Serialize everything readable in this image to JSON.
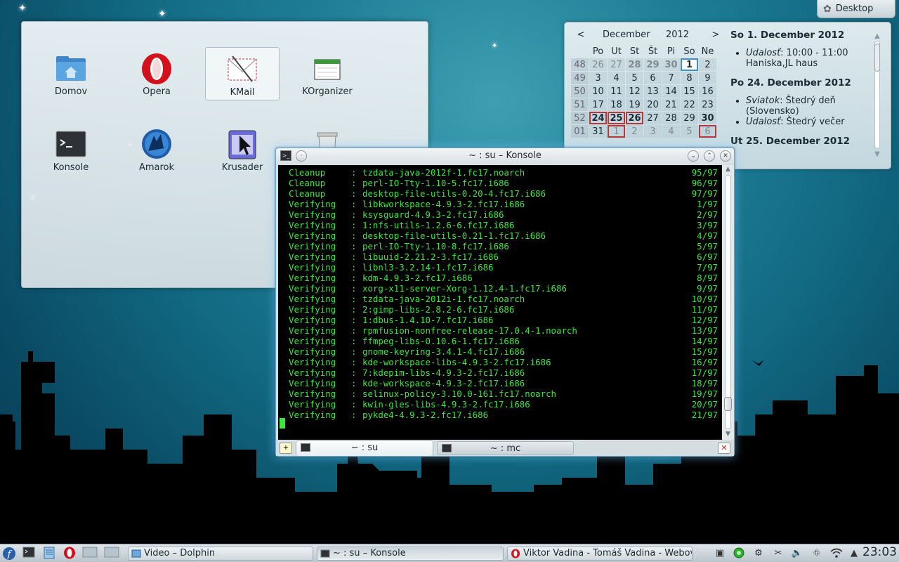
{
  "toolbox": {
    "label": "Desktop"
  },
  "folderview": {
    "items": [
      {
        "label": "Domov"
      },
      {
        "label": "Opera"
      },
      {
        "label": "KMail"
      },
      {
        "label": "KOrganizer"
      },
      {
        "label": "Konsole"
      },
      {
        "label": "Amarok"
      },
      {
        "label": "Krusader"
      }
    ]
  },
  "calendar": {
    "prev": "<",
    "next": ">",
    "month": "December",
    "year": "2012",
    "weekdays": [
      "Po",
      "Ut",
      "St",
      "Št",
      "Pi",
      "So",
      "Ne"
    ],
    "weeks": [
      {
        "num": "48",
        "days": [
          "26",
          "27",
          "28",
          "29",
          "30",
          "1",
          "2"
        ]
      },
      {
        "num": "49",
        "days": [
          "3",
          "4",
          "5",
          "6",
          "7",
          "8",
          "9"
        ]
      },
      {
        "num": "50",
        "days": [
          "10",
          "11",
          "12",
          "13",
          "14",
          "15",
          "16"
        ]
      },
      {
        "num": "51",
        "days": [
          "17",
          "18",
          "19",
          "20",
          "21",
          "22",
          "23"
        ]
      },
      {
        "num": "52",
        "days": [
          "24",
          "25",
          "26",
          "27",
          "28",
          "29",
          "30"
        ]
      },
      {
        "num": "01",
        "days": [
          "31",
          "1",
          "2",
          "3",
          "4",
          "5",
          "6"
        ]
      }
    ],
    "events": [
      {
        "date": "So 1. December 2012",
        "items": [
          {
            "kind": "Udalosť",
            "text": ": 10:00 - 11:00 Haniska,JL haus"
          }
        ]
      },
      {
        "date": "Po 24. December 2012",
        "items": [
          {
            "kind": "Sviatok",
            "text": ": Štedrý deň (Slovensko)"
          },
          {
            "kind": "Udalosť",
            "text": ": Štedrý večer"
          }
        ]
      },
      {
        "date": "Ut 25. December 2012",
        "items": []
      }
    ]
  },
  "konsole": {
    "title": "~ : su – Konsole",
    "lines": [
      {
        "action": "Cleanup",
        "package": "tzdata-java-2012f-1.fc17.noarch",
        "count": "95/97"
      },
      {
        "action": "Cleanup",
        "package": "perl-IO-Tty-1.10-5.fc17.i686",
        "count": "96/97"
      },
      {
        "action": "Cleanup",
        "package": "desktop-file-utils-0.20-4.fc17.i686",
        "count": "97/97"
      },
      {
        "action": "Verifying",
        "package": "libkworkspace-4.9.3-2.fc17.i686",
        "count": "1/97"
      },
      {
        "action": "Verifying",
        "package": "ksysguard-4.9.3-2.fc17.i686",
        "count": "2/97"
      },
      {
        "action": "Verifying",
        "package": "1:nfs-utils-1.2.6-6.fc17.i686",
        "count": "3/97"
      },
      {
        "action": "Verifying",
        "package": "desktop-file-utils-0.21-1.fc17.i686",
        "count": "4/97"
      },
      {
        "action": "Verifying",
        "package": "perl-IO-Tty-1.10-8.fc17.i686",
        "count": "5/97"
      },
      {
        "action": "Verifying",
        "package": "libuuid-2.21.2-3.fc17.i686",
        "count": "6/97"
      },
      {
        "action": "Verifying",
        "package": "libnl3-3.2.14-1.fc17.i686",
        "count": "7/97"
      },
      {
        "action": "Verifying",
        "package": "kdm-4.9.3-2.fc17.i686",
        "count": "8/97"
      },
      {
        "action": "Verifying",
        "package": "xorg-x11-server-Xorg-1.12.4-1.fc17.i686",
        "count": "9/97"
      },
      {
        "action": "Verifying",
        "package": "tzdata-java-2012i-1.fc17.noarch",
        "count": "10/97"
      },
      {
        "action": "Verifying",
        "package": "2:gimp-libs-2.8.2-6.fc17.i686",
        "count": "11/97"
      },
      {
        "action": "Verifying",
        "package": "1:dbus-1.4.10-7.fc17.i686",
        "count": "12/97"
      },
      {
        "action": "Verifying",
        "package": "rpmfusion-nonfree-release-17.0.4-1.noarch",
        "count": "13/97"
      },
      {
        "action": "Verifying",
        "package": "ffmpeg-libs-0.10.6-1.fc17.i686",
        "count": "14/97"
      },
      {
        "action": "Verifying",
        "package": "gnome-keyring-3.4.1-4.fc17.i686",
        "count": "15/97"
      },
      {
        "action": "Verifying",
        "package": "kde-workspace-libs-4.9.3-2.fc17.i686",
        "count": "16/97"
      },
      {
        "action": "Verifying",
        "package": "7:kdepim-libs-4.9.3-2.fc17.i686",
        "count": "17/97"
      },
      {
        "action": "Verifying",
        "package": "kde-workspace-4.9.3-2.fc17.i686",
        "count": "18/97"
      },
      {
        "action": "Verifying",
        "package": "selinux-policy-3.10.0-161.fc17.noarch",
        "count": "19/97"
      },
      {
        "action": "Verifying",
        "package": "kwin-gles-libs-4.9.3-2.fc17.i686",
        "count": "20/97"
      },
      {
        "action": "Verifying",
        "package": "pykde4-4.9.3-2.fc17.i686",
        "count": "21/97"
      }
    ],
    "tabs": [
      {
        "label": "~ : su"
      },
      {
        "label": "~ : mc"
      }
    ]
  },
  "taskbar": {
    "tasks": [
      {
        "label": "Video – Dolphin"
      },
      {
        "label": "~ : su – Konsole"
      },
      {
        "label": "Viktor Vadina - Tomáš Vadina - Webov"
      }
    ],
    "clock": "23:03"
  }
}
